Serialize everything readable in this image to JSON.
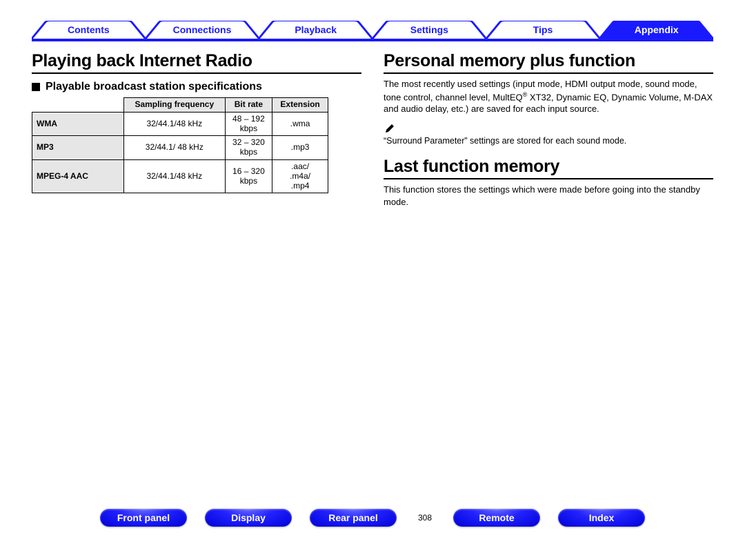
{
  "topnav": {
    "items": [
      {
        "label": "Contents"
      },
      {
        "label": "Connections"
      },
      {
        "label": "Playback"
      },
      {
        "label": "Settings"
      },
      {
        "label": "Tips"
      },
      {
        "label": "Appendix"
      }
    ],
    "activeIndex": 5
  },
  "left": {
    "h1": "Playing back Internet Radio",
    "h2": "Playable broadcast station specifications",
    "table": {
      "headers": [
        "Sampling frequency",
        "Bit rate",
        "Extension"
      ],
      "rows": [
        {
          "fmt": "WMA",
          "freq": "32/44.1/48 kHz",
          "rate": "48 – 192\nkbps",
          "ext": ".wma"
        },
        {
          "fmt": "MP3",
          "freq": "32/44.1/ 48 kHz",
          "rate": "32 – 320\nkbps",
          "ext": ".mp3"
        },
        {
          "fmt": "MPEG-4 AAC",
          "freq": "32/44.1/48 kHz",
          "rate": "16 – 320\nkbps",
          "ext": ".aac/\n.m4a/\n.mp4"
        }
      ]
    }
  },
  "right": {
    "h1a": "Personal memory plus function",
    "p1_pre": "The most recently used settings (input mode, HDMI output mode, sound mode, tone control, channel level, MultEQ",
    "p1_post": " XT32, Dynamic EQ, Dynamic Volume, M-DAX and audio delay, etc.) are saved for each input source.",
    "note": "“Surround Parameter” settings are stored for each sound mode.",
    "h1b": "Last function memory",
    "p2": "This function stores the settings which were made before going into the standby mode."
  },
  "bottomnav": {
    "items": [
      {
        "label": "Front panel"
      },
      {
        "label": "Display"
      },
      {
        "label": "Rear panel"
      }
    ],
    "page": "308",
    "items2": [
      {
        "label": "Remote"
      },
      {
        "label": "Index"
      }
    ]
  }
}
